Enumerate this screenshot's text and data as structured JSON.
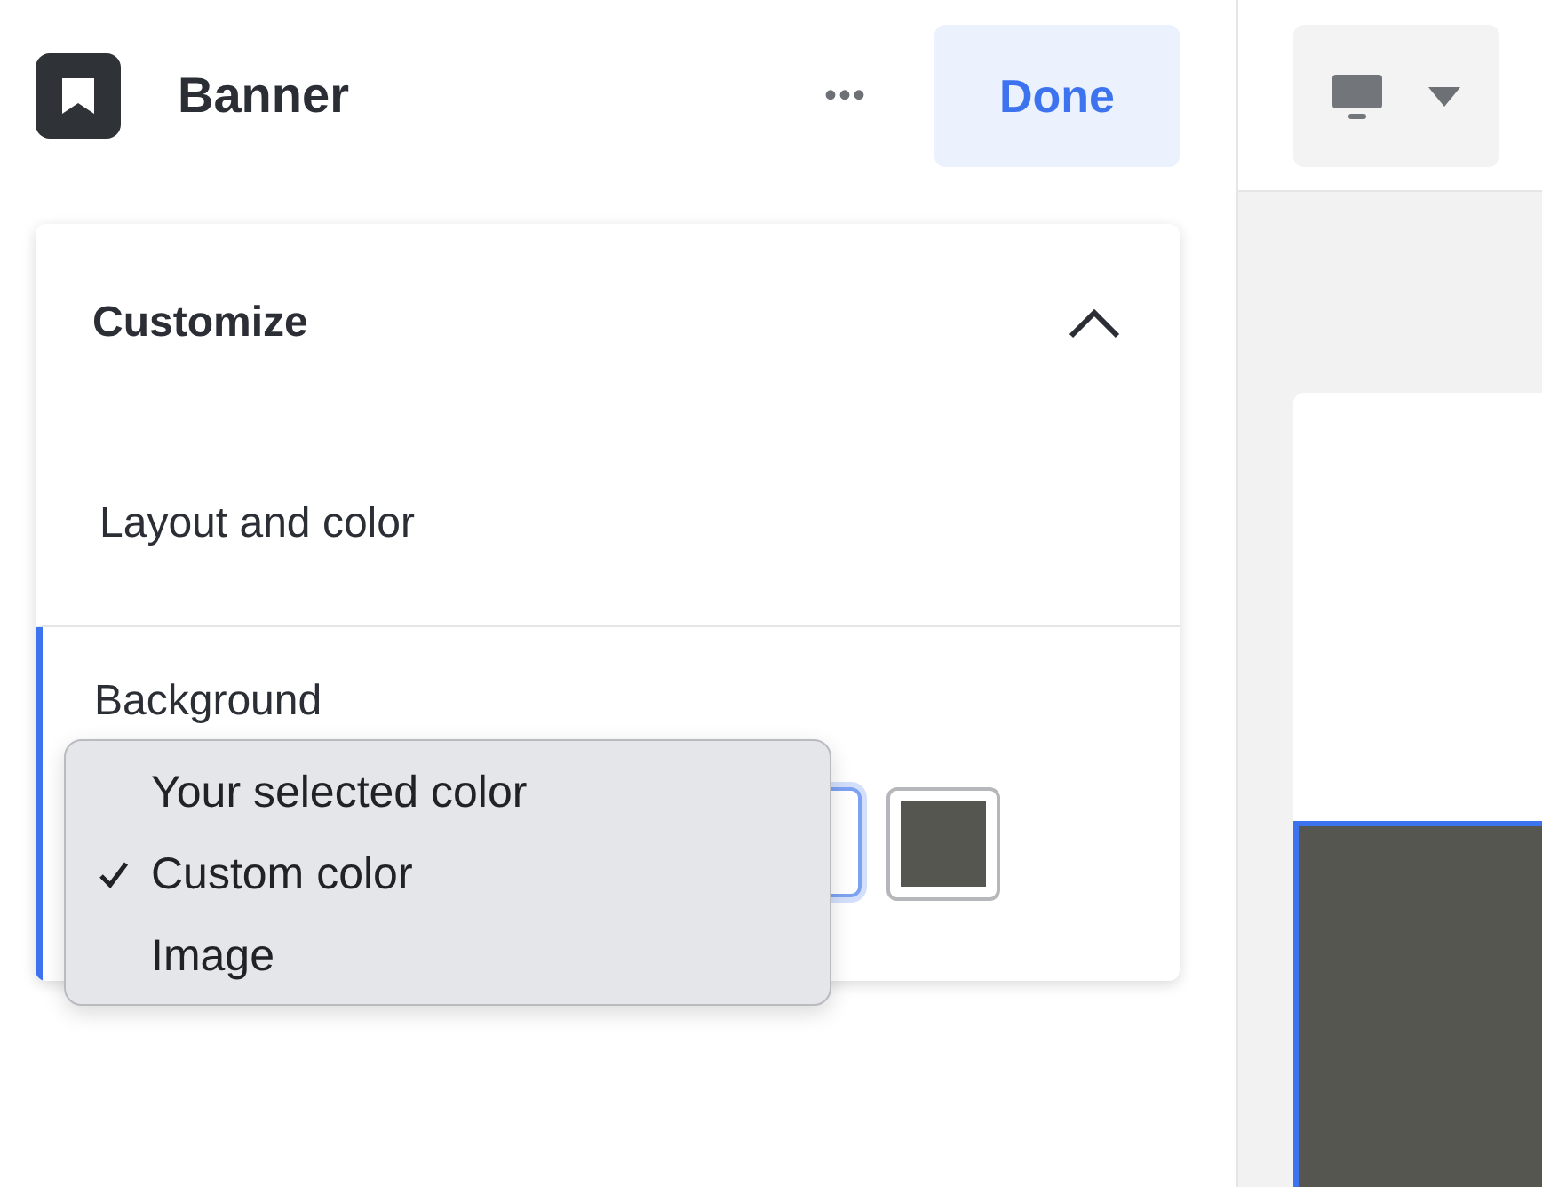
{
  "header": {
    "title": "Banner",
    "more": "•••",
    "done": "Done"
  },
  "customize": {
    "title": "Customize",
    "expanded": true,
    "sections": [
      {
        "label": "Layout and color",
        "selected": false
      },
      {
        "label": "Background",
        "selected": true
      }
    ]
  },
  "swatch": {
    "color": "#565651"
  },
  "menu": {
    "items": [
      {
        "label": "Your selected color",
        "checked": false
      },
      {
        "label": "Custom color",
        "checked": true
      },
      {
        "label": "Image",
        "checked": false
      }
    ]
  },
  "preview": {
    "color": "#565651"
  }
}
